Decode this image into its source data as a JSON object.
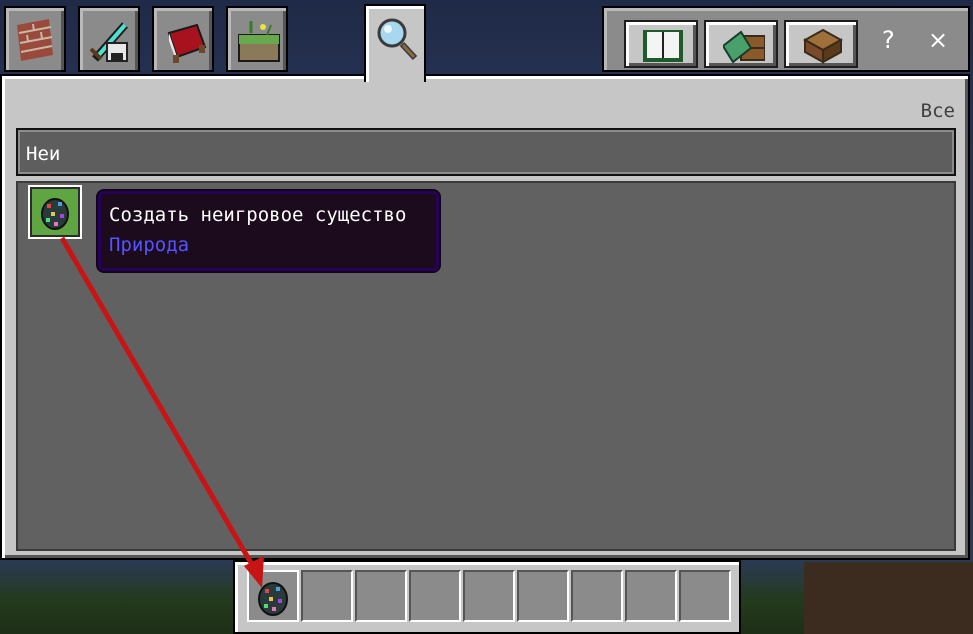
{
  "tabs": [
    {
      "name": "construction",
      "icon": "bricks-icon"
    },
    {
      "name": "equipment",
      "icon": "diamond-sword-helmet-icon"
    },
    {
      "name": "items",
      "icon": "red-bed-icon"
    },
    {
      "name": "nature",
      "icon": "grass-block-icon"
    },
    {
      "name": "search",
      "icon": "magnifier-icon",
      "active": true
    }
  ],
  "right_buttons": [
    {
      "name": "recipe-book",
      "icon": "open-book-icon"
    },
    {
      "name": "craftable-toggle",
      "icon": "book-chest-icon"
    },
    {
      "name": "crafting",
      "icon": "crafting-table-icon"
    }
  ],
  "help_label": "?",
  "close_label": "×",
  "filter_label": "Все",
  "search": {
    "value": "Неи"
  },
  "results": [
    {
      "icon": "spawn-egg-icon",
      "selected": true
    }
  ],
  "tooltip": {
    "title": "Создать неигровое существо",
    "category": "Природа"
  },
  "hotbar": {
    "slot_count": 9,
    "items": [
      {
        "slot": 0,
        "icon": "spawn-egg-icon"
      }
    ]
  },
  "annotation": {
    "type": "arrow",
    "color": "#c81414"
  },
  "colors": {
    "panel": "#c6c6c6",
    "grid": "#616161",
    "tooltip_bg": "#1b0b1c",
    "tooltip_category": "#5555ff",
    "selected_slot": "#5fa541"
  }
}
